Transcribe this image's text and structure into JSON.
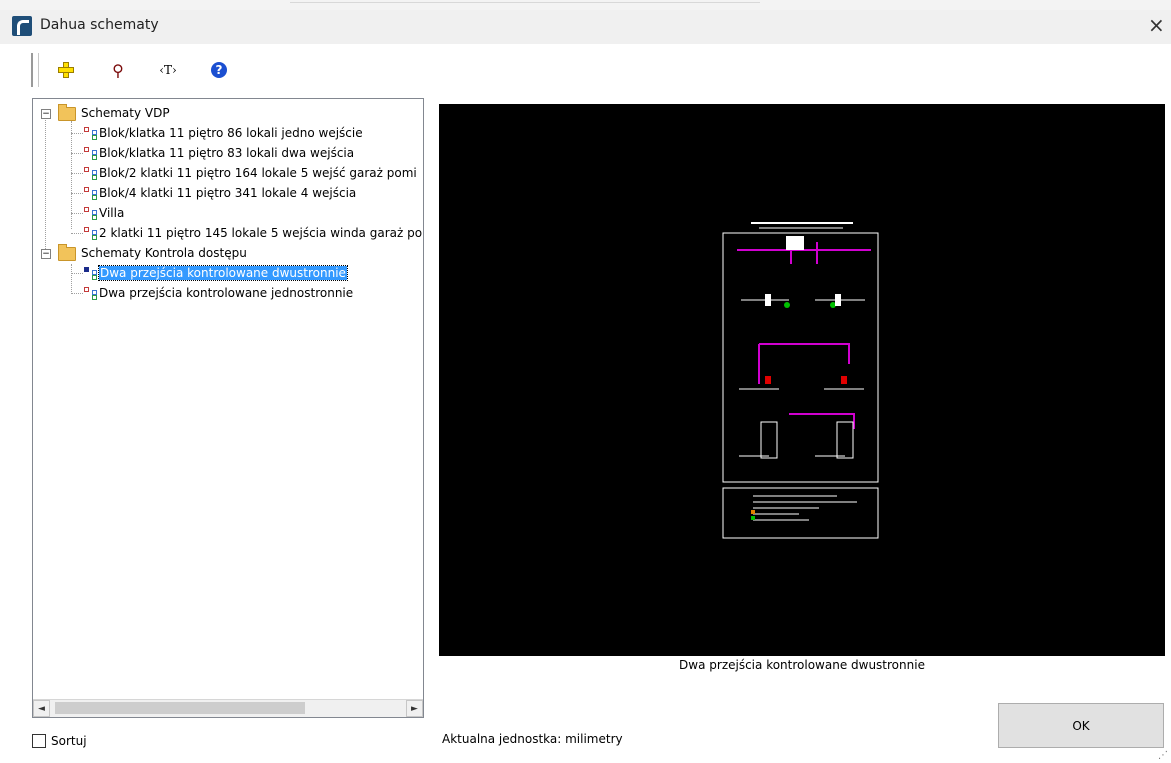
{
  "window": {
    "title": "Dahua schematy",
    "close_symbol": "×"
  },
  "toolbar": {
    "add_icon": "plus-icon",
    "find_icon": "binoculars-icon",
    "text_tool_label": "‹T›",
    "help_label": "?"
  },
  "tree": {
    "groups": [
      {
        "label": "Schematy VDP",
        "items": [
          "Blok/klatka 11 piętro 86 lokali jedno wejście",
          "Blok/klatka 11 piętro 83 lokali dwa wejścia",
          "Blok/2 klatki 11 piętro 164 lokale 5 wejść garaż pomi",
          "Blok/4 klatki 11 piętro 341 lokale 4 wejścia",
          "Villa",
          "2 klatki 11 piętro 145 lokale 5 wejścia winda garaż po"
        ]
      },
      {
        "label": "Schematy Kontrola dostępu",
        "items": [
          "Dwa przejścia kontrolowane dwustronnie",
          "Dwa przejścia kontrolowane jednostronnie"
        ]
      }
    ],
    "selected": "Dwa przejścia kontrolowane dwustronnie"
  },
  "scroll": {
    "left_arrow": "◄",
    "right_arrow": "►"
  },
  "sortuj_label": "Sortuj",
  "sortuj_checked": false,
  "preview": {
    "caption": "Dwa przejścia kontrolowane dwustronnie"
  },
  "unit_text": "Aktualna jednostka: milimetry",
  "ok_label": "OK"
}
